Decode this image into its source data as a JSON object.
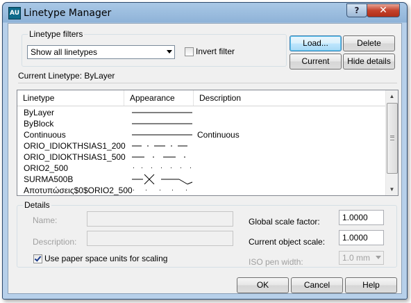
{
  "window": {
    "title": "Linetype Manager",
    "app_icon_text": "AU",
    "help_glyph": "?",
    "close_glyph": "✕"
  },
  "filters": {
    "legend": "Linetype filters",
    "selected": "Show all linetypes",
    "invert_label": "Invert filter",
    "invert_checked": false
  },
  "buttons": {
    "load": "Load...",
    "delete": "Delete",
    "current": "Current",
    "hide_details": "Hide details",
    "ok": "OK",
    "cancel": "Cancel",
    "help": "Help"
  },
  "current_linetype": {
    "label": "Current Linetype:",
    "value": "ByLayer"
  },
  "list": {
    "columns": [
      "Linetype",
      "Appearance",
      "Description"
    ],
    "rows": [
      {
        "name": "ByLayer",
        "pattern": "solid",
        "description": ""
      },
      {
        "name": "ByBlock",
        "pattern": "solid",
        "description": ""
      },
      {
        "name": "Continuous",
        "pattern": "solid",
        "description": "Continuous"
      },
      {
        "name": "ORIO_IDIOKTHSIAS1_200",
        "pattern": "dash-dot",
        "description": ""
      },
      {
        "name": "ORIO_IDIOKTHSIAS1_500",
        "pattern": "dash-dot-wide",
        "description": ""
      },
      {
        "name": "ORIO2_500",
        "pattern": "dots",
        "description": ""
      },
      {
        "name": "SURMA500B",
        "pattern": "fence",
        "description": ""
      },
      {
        "name": "Αποτυπώσεις$0$ORIO2_500",
        "pattern": "dots-sparse",
        "description": ""
      }
    ]
  },
  "details": {
    "legend": "Details",
    "name_label": "Name:",
    "name_value": "",
    "description_label": "Description:",
    "description_value": "",
    "paper_space_label": "Use paper space units for scaling",
    "paper_space_checked": true,
    "global_scale_label": "Global scale factor:",
    "global_scale_value": "1.0000",
    "object_scale_label": "Current object scale:",
    "object_scale_value": "1.0000",
    "iso_pen_label": "ISO pen width:",
    "iso_pen_value": "1.0 mm"
  },
  "colors": {
    "title_bar": "#9fbfe0",
    "default_button": "#bee6fd",
    "close_button": "#c4422c"
  }
}
